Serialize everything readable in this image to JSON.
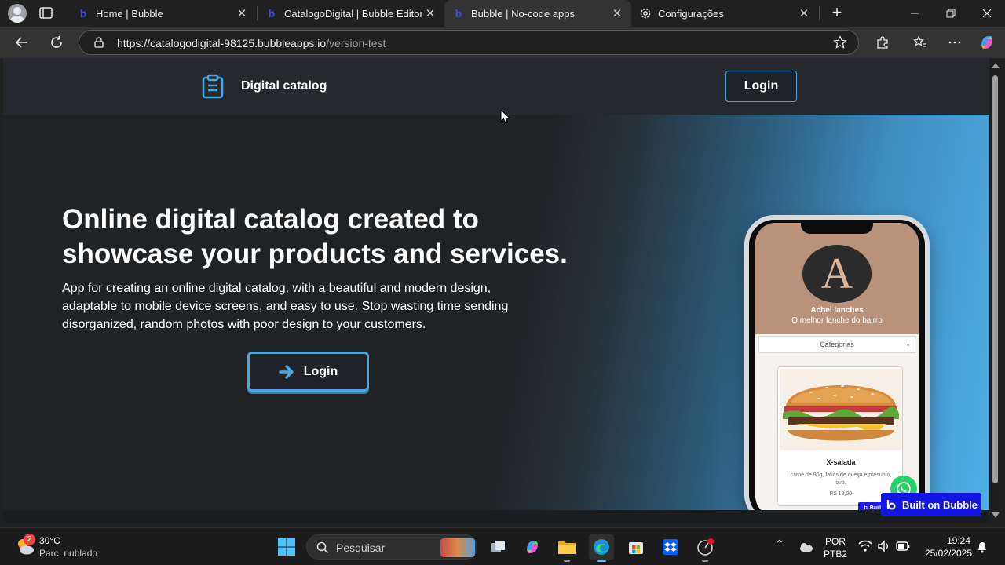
{
  "browser": {
    "tabs": [
      {
        "title": "Home | Bubble"
      },
      {
        "title": "CatalogoDigital | Bubble Editor"
      },
      {
        "title": "Bubble | No-code apps"
      },
      {
        "title": "Configurações"
      }
    ],
    "url": {
      "host": "https://catalogodigital-98125.bubbleapps.io",
      "path": "/version-test"
    }
  },
  "site": {
    "brand": "Digital catalog",
    "header_login": "Login",
    "hero": {
      "title": "Online digital catalog created to showcase your products and services.",
      "description": "App for creating an online digital catalog, with a beautiful and modern design, adaptable to mobile device screens, and easy to use. Stop wasting time sending disorganized, random photos with poor design to your customers.",
      "login_label": "Login"
    },
    "built_on_bubble": "Built on Bubble",
    "accent_color": "#4aa6e0"
  },
  "phone_app": {
    "logo_letter": "A",
    "store_name": "Achei lanches",
    "slogan": "O melhor lanche do bairro",
    "category_select": "Categorias",
    "product": {
      "name": "X-salada",
      "description": "carne de 90g, fatias de queijo e presunto, ovo.",
      "price": "R$ 13,00"
    },
    "built_on_bubble": "Built on Bubble"
  },
  "taskbar": {
    "weather": {
      "badge": "2",
      "temp": "30°C",
      "desc": "Parc. nublado"
    },
    "search_label": "Pesquisar",
    "language": {
      "line1": "POR",
      "line2": "PTB2"
    },
    "clock": {
      "time": "19:24",
      "date": "25/02/2025"
    }
  }
}
